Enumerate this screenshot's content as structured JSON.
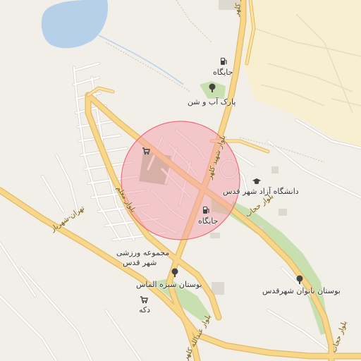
{
  "map": {
    "selection_circle": {
      "fill": "#f4a0aa",
      "stroke": "#e8707e"
    },
    "colors": {
      "background": "#f2efe9",
      "urban_yellow": "#f7efcf",
      "water": "#b5d0e8",
      "park": "#c8dfb0",
      "major_road": "#f8d68a",
      "major_road_casing": "#e3b965",
      "minor_road": "#ffffff",
      "minor_road_casing": "#d9d4cc"
    }
  },
  "places": {
    "gas_station_north": {
      "label": "جایگاه",
      "icon": "fuel-icon"
    },
    "park_ab_o_shen": {
      "label": "پارک آب و شن",
      "icon": "tree-icon"
    },
    "azad_university": {
      "label": "دانشگاه آزاد شهر قدس",
      "icon": "graduation-cap-icon"
    },
    "gas_station_center": {
      "label": "جایگاه",
      "icon": "fuel-icon"
    },
    "sports_complex": {
      "label_line1": "مجموعه ورزشی",
      "label_line2": "شهر قدس"
    },
    "sabz_almas_park": {
      "label": "بوستان سبزه الماس",
      "icon": "tree-icon"
    },
    "banovan_park": {
      "label": "بوستان بانوان شهرقدس",
      "icon": "tree-icon"
    },
    "shop": {
      "label": "دکه",
      "icon": "shop-cart-icon"
    },
    "shop_center": {
      "icon": "shop-cart-icon"
    }
  },
  "roads": {
    "shahid_kalhor_top": "بلوار شهید کلهر",
    "shahid_kalhor_mid": "بلوار شهید کلهر",
    "moallem": "بلوار معلم",
    "hejab": "بلوار حجاب",
    "hejab_bottom": "بلوار حجاب",
    "tehran_shahriar": "تهران-شهریار",
    "abdollah": "بلوار عبدالله کلهر"
  }
}
